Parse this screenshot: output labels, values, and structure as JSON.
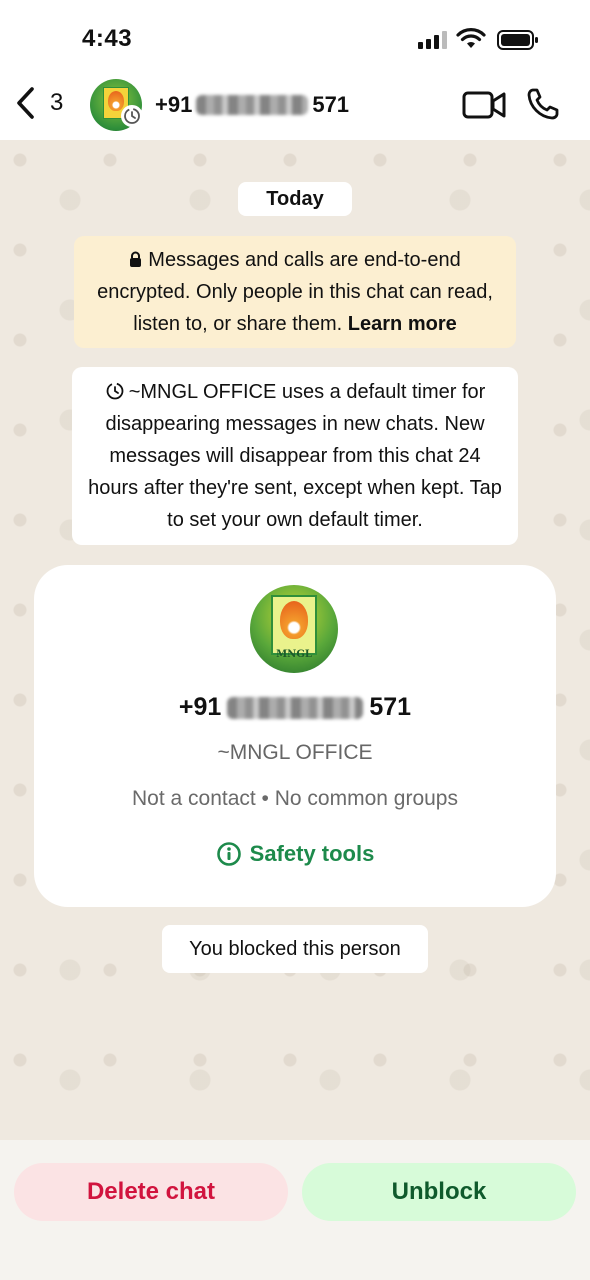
{
  "status_bar": {
    "time": "4:43"
  },
  "header": {
    "back_count": "3",
    "contact_prefix": "+91",
    "contact_suffix": "571"
  },
  "chat": {
    "date_label": "Today",
    "encryption_text": "Messages and calls are end-to-end encrypted. Only people in this chat can read, listen to, or share them.",
    "encryption_link": "Learn more",
    "timer_text": "~MNGL OFFICE uses a default timer for disappearing messages in new chats. New messages will disappear from this chat 24 hours after they're sent, except when kept. Tap to set your own default timer.",
    "blocked_text": "You blocked this person"
  },
  "profile_card": {
    "avatar_brand": "MNGL",
    "number_prefix": "+91",
    "number_suffix": "571",
    "display_name": "~MNGL OFFICE",
    "meta": "Not a contact • No common groups",
    "safety_label": "Safety tools"
  },
  "actions": {
    "delete_label": "Delete chat",
    "unblock_label": "Unblock"
  },
  "colors": {
    "accent_green": "#1d8a4b",
    "delete_red": "#d1143e",
    "encryption_bg": "#fcefd1"
  }
}
